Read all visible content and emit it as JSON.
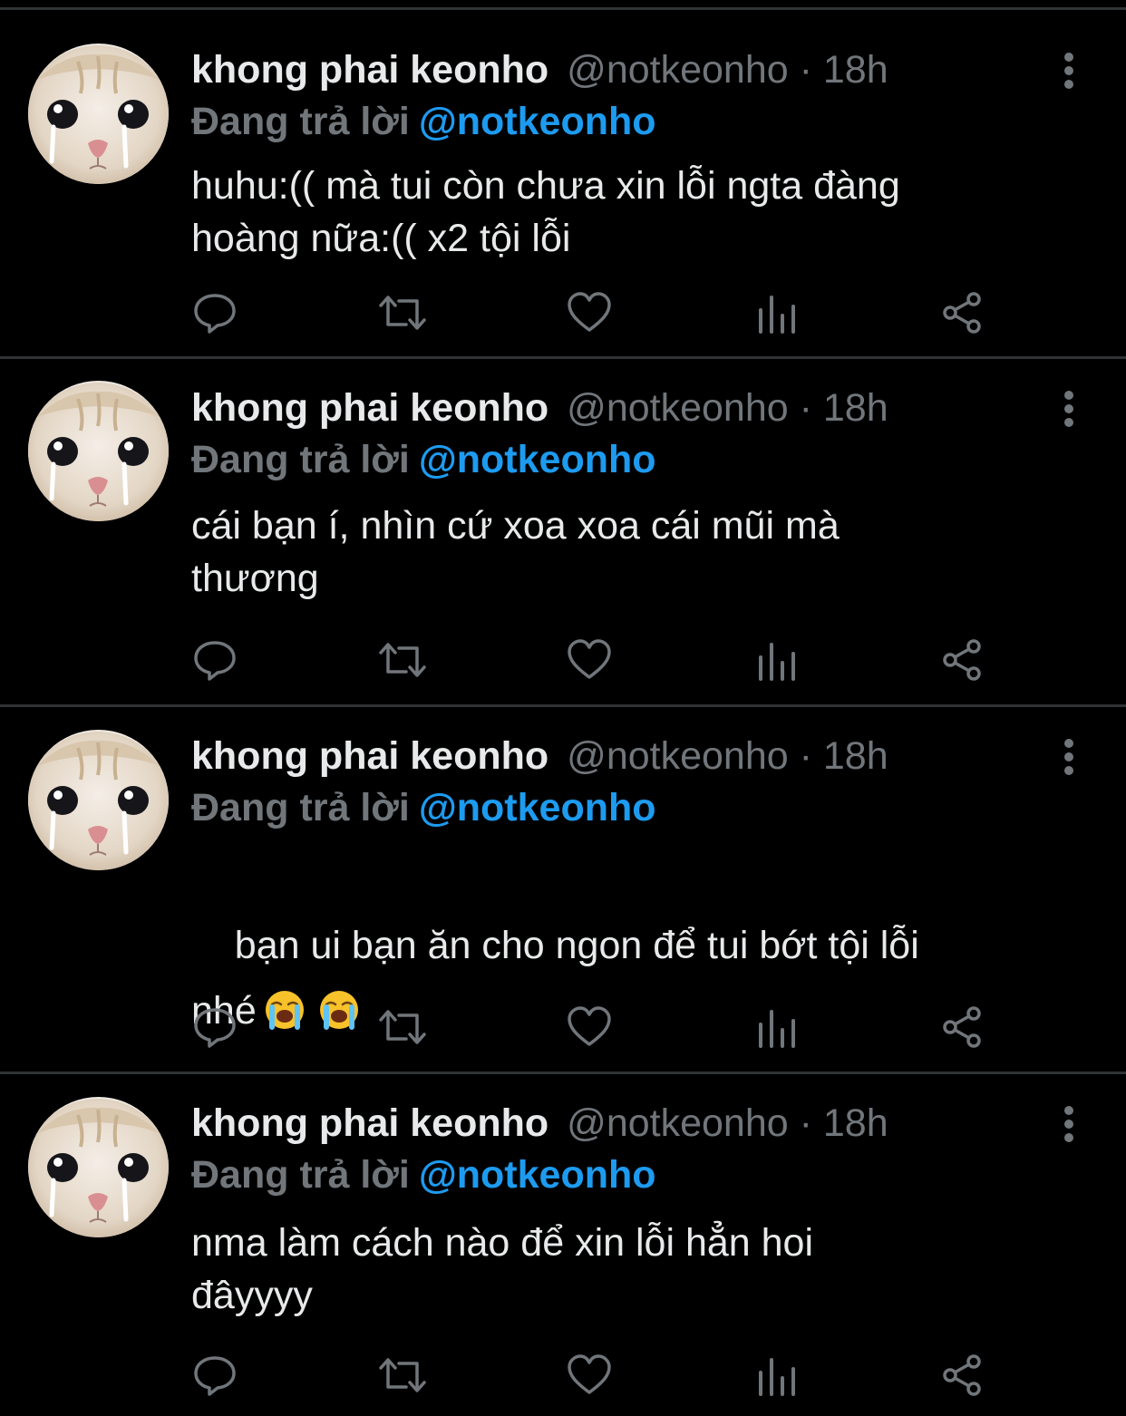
{
  "colors": {
    "background": "#000000",
    "primary_text": "#e7e9ea",
    "secondary_text": "#71767b",
    "accent_blue": "#1d9bf0",
    "divider": "#2f3336"
  },
  "icons": {
    "reply": "comment-bubble-icon",
    "retweet": "retweet-arrows-icon",
    "like": "heart-icon",
    "views": "analytics-bars-icon",
    "share": "share-nodes-icon",
    "more": "vertical-ellipsis-icon"
  },
  "tweets": [
    {
      "display_name": "khong phai keonho",
      "handle_time": "@notkeonho · 18h",
      "reply_prefix": "Đang trả lời",
      "reply_handle": "@notkeonho",
      "text": "huhu:(( mà tui còn chưa xin lỗi ngta đàng\nhoàng nữa:(( x2 tội lỗi",
      "emoji": []
    },
    {
      "display_name": "khong phai keonho",
      "handle_time": "@notkeonho · 18h",
      "reply_prefix": "Đang trả lời",
      "reply_handle": "@notkeonho",
      "text": "cái bạn í, nhìn cứ xoa xoa cái mũi mà\nthương",
      "emoji": []
    },
    {
      "display_name": "khong phai keonho",
      "handle_time": "@notkeonho · 18h",
      "reply_prefix": "Đang trả lời",
      "reply_handle": "@notkeonho",
      "text": "bạn ui bạn ăn cho ngon để tui bớt tội lỗi\nnhé",
      "emoji": [
        "loudly-crying-face",
        "loudly-crying-face"
      ]
    },
    {
      "display_name": "khong phai keonho",
      "handle_time": "@notkeonho · 18h",
      "reply_prefix": "Đang trả lời",
      "reply_handle": "@notkeonho",
      "text": "nma làm cách nào để xin lỗi hẳn hoi\nđâyyyy",
      "emoji": []
    }
  ]
}
